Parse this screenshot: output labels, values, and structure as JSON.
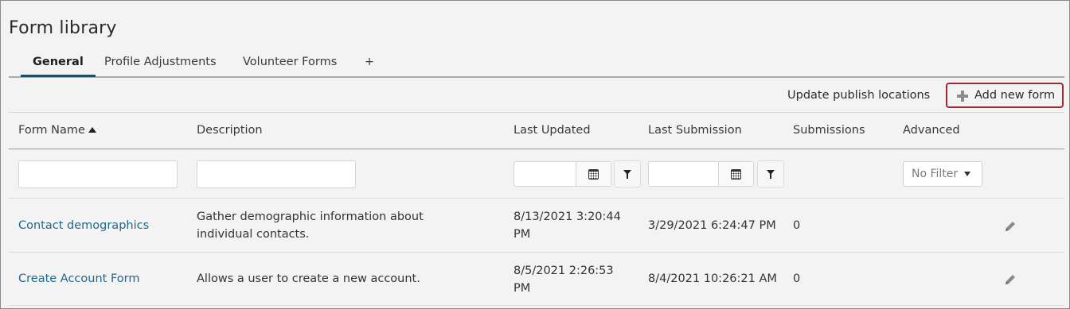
{
  "page": {
    "title": "Form library"
  },
  "tabs": [
    {
      "label": "General",
      "active": true
    },
    {
      "label": "Profile Adjustments",
      "active": false
    },
    {
      "label": "Volunteer Forms",
      "active": false
    },
    {
      "label": "+",
      "active": false
    }
  ],
  "toolbar": {
    "update_publish_label": "Update publish locations",
    "add_new_label": "Add new form"
  },
  "table": {
    "columns": [
      "Form Name",
      "Description",
      "Last Updated",
      "Last Submission",
      "Submissions",
      "Advanced"
    ],
    "sort": {
      "column": "Form Name",
      "direction": "ascending"
    },
    "filters": {
      "advanced_selected": "No Filter"
    },
    "rows": [
      {
        "name": "Contact demographics",
        "description_line1": "Gather demographic information about",
        "description_line2": "individual contacts.",
        "last_updated_line1": "8/13/2021 3:20:44",
        "last_updated_line2": "PM",
        "last_submission": "3/29/2021 6:24:47 PM",
        "submissions": "0"
      },
      {
        "name": "Create Account Form",
        "description_line1": "Allows a user to create a new account.",
        "description_line2": "",
        "last_updated_line1": "8/5/2021 2:26:53",
        "last_updated_line2": "PM",
        "last_submission": "8/4/2021 10:26:21 AM",
        "submissions": "0"
      }
    ]
  },
  "colors": {
    "link": "#1f6a8a",
    "active_tab_underline": "#1f4e64",
    "add_button_border": "#9b2a35"
  },
  "icons": [
    "plus-icon",
    "sort-ascending-icon",
    "calendar-icon",
    "filter-icon",
    "caret-down-icon",
    "pencil-icon"
  ]
}
